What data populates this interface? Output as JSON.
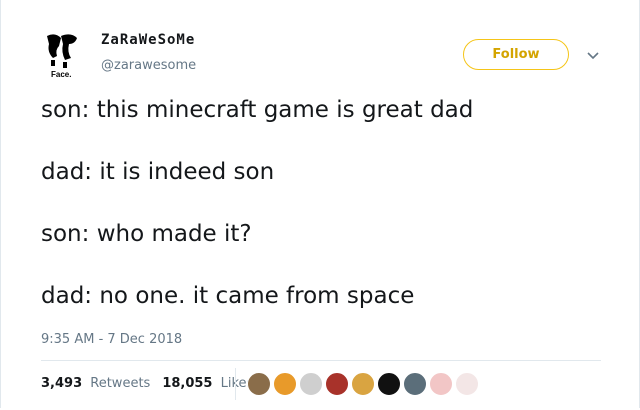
{
  "user": {
    "display_name": "ZaRaWeSoMe",
    "handle": "@zarawesome",
    "avatar_label": "Face."
  },
  "follow_label": "Follow",
  "tweet_lines": [
    "son: this minecraft game is great dad",
    "dad: it is indeed son",
    "son: who made it?",
    "dad: no one. it came from space"
  ],
  "timestamp": "9:35 AM - 7 Dec 2018",
  "stats": {
    "retweets_count": "3,493",
    "retweets_label": "Retweets",
    "likes_count": "18,055",
    "likes_label": "Likes"
  },
  "liker_avatars": [
    {
      "name": "liker-1",
      "color": "#8a6d4a"
    },
    {
      "name": "liker-2",
      "color": "#e89a2a"
    },
    {
      "name": "liker-3",
      "color": "#cfcfcf"
    },
    {
      "name": "liker-4",
      "color": "#a8322a"
    },
    {
      "name": "liker-5",
      "color": "#d9a441"
    },
    {
      "name": "liker-6",
      "color": "#111111"
    },
    {
      "name": "liker-7",
      "color": "#5b6e7a"
    },
    {
      "name": "liker-8",
      "color": "#f2c6c6"
    },
    {
      "name": "liker-9",
      "color": "#f3e6e6"
    }
  ],
  "colors": {
    "follow_accent": "#f5c518",
    "text": "#14171a",
    "muted": "#657786"
  }
}
